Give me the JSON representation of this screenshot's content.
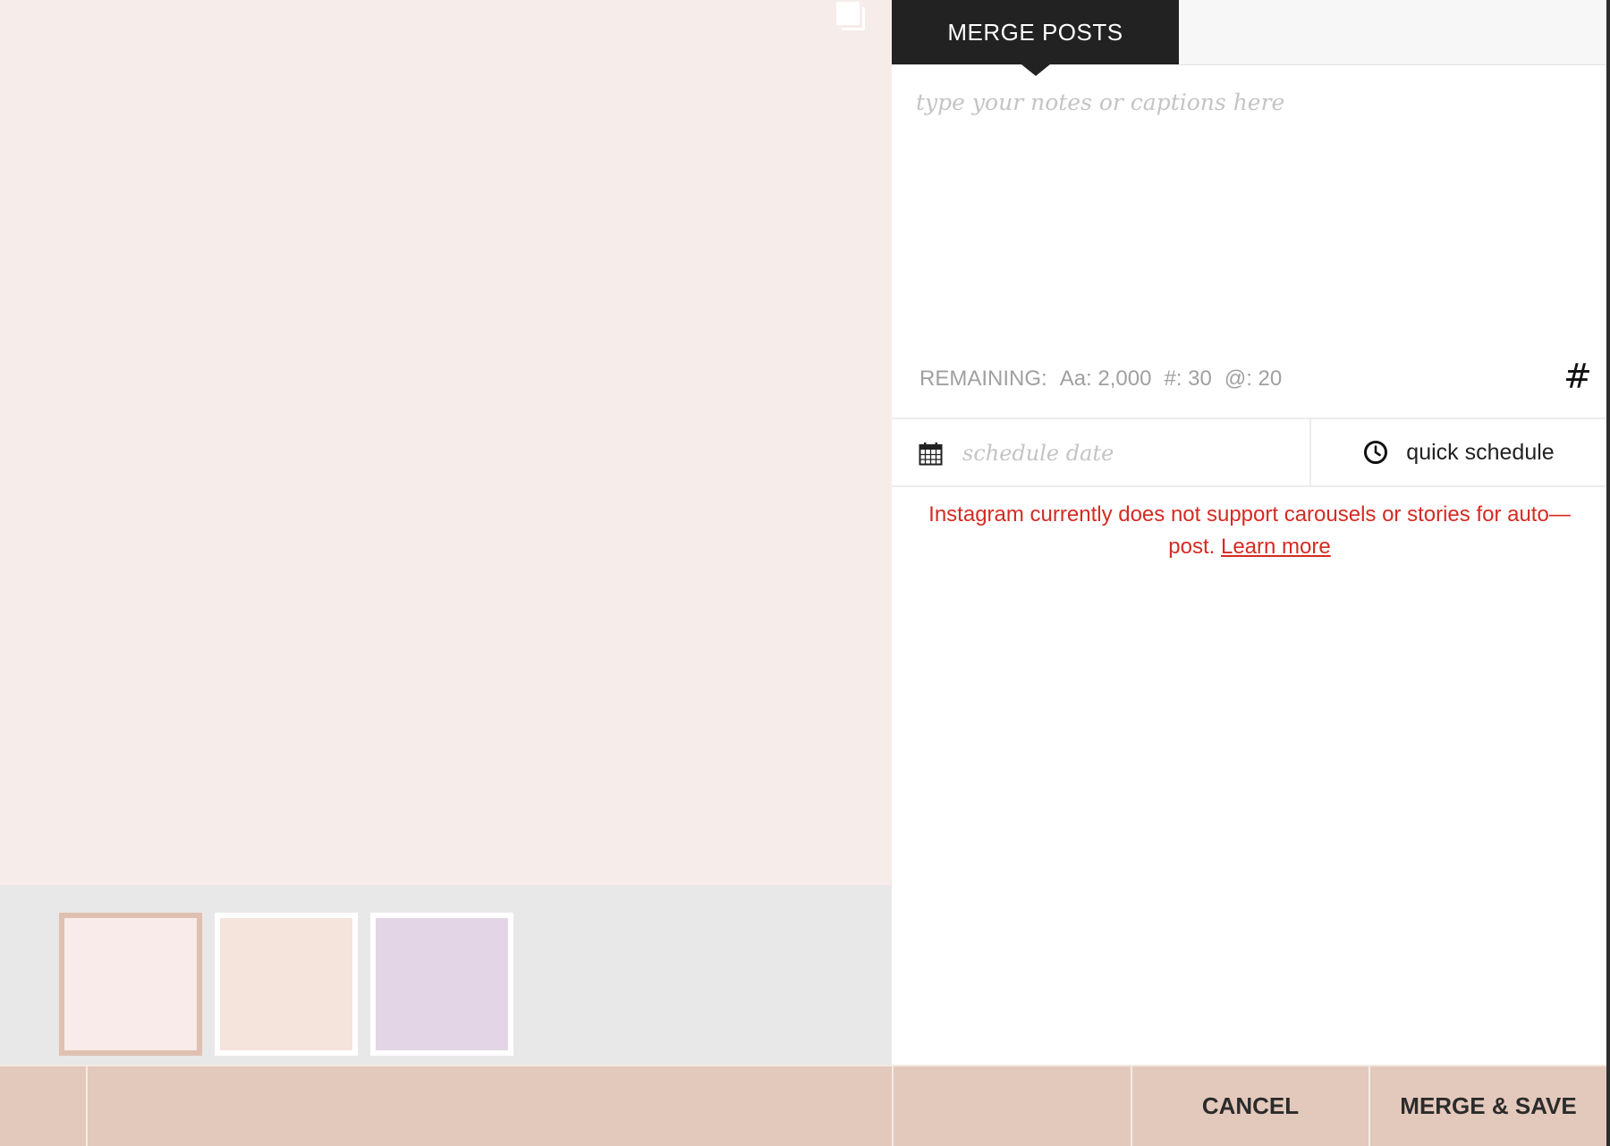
{
  "tabs": {
    "active_label": "MERGE POSTS"
  },
  "caption": {
    "placeholder": "type your notes or captions here",
    "value": ""
  },
  "remaining": {
    "label": "REMAINING:",
    "chars": "Aa: 2,000",
    "hashtags": "#: 30",
    "mentions": "@: 20"
  },
  "hashtag_button_glyph": "#",
  "schedule": {
    "date_placeholder": "schedule date",
    "quick_label": "quick schedule"
  },
  "warning": {
    "text": "Instagram currently does not support carousels or stories for auto—post. ",
    "link": "Learn more"
  },
  "thumbnails": [
    {
      "color": "#f8ebe9",
      "selected": true
    },
    {
      "color": "#f5e4dc",
      "selected": false
    },
    {
      "color": "#e3d5e6",
      "selected": false
    }
  ],
  "actions": {
    "cancel": "CANCEL",
    "save": "MERGE & SAVE"
  },
  "colors": {
    "preview_bg": "#f6ecea",
    "accent_bar": "#e3c9bc",
    "tab_dark": "#222222",
    "warning_red": "#d42b23"
  },
  "icons": [
    "carousel-icon",
    "hashtag-icon",
    "calendar-icon",
    "clock-icon"
  ]
}
